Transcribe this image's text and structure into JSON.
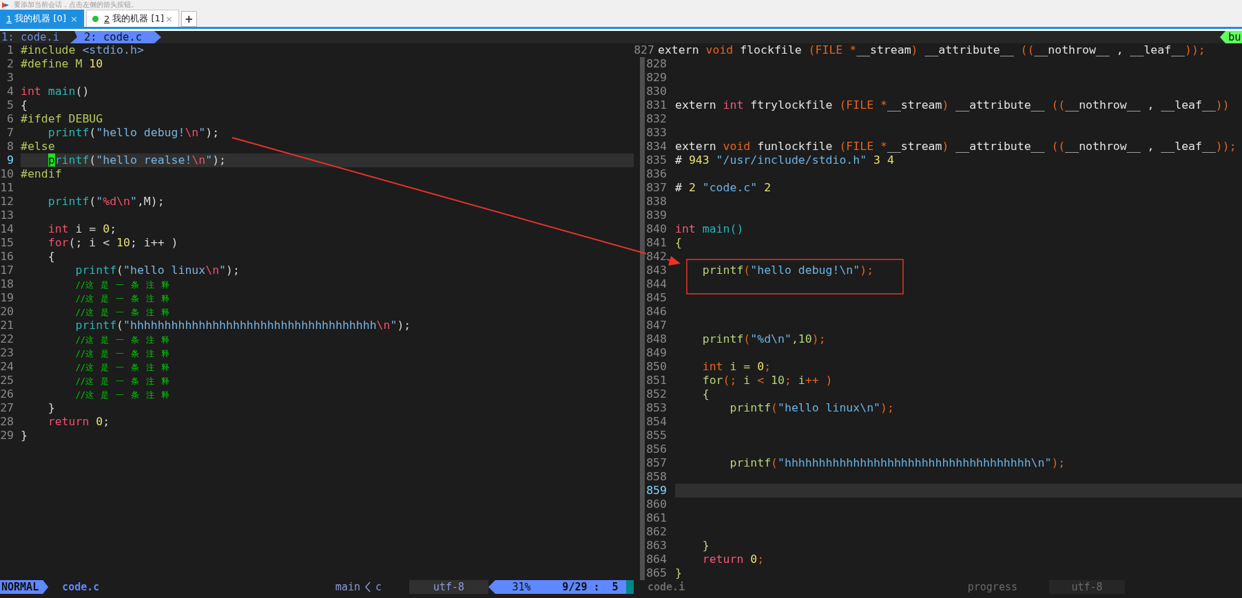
{
  "notice": {
    "text": "要添加当前会话，点击左侧的箭头按钮。"
  },
  "tabs": [
    {
      "number": "1",
      "label": "我的机器 [0]",
      "selected": true,
      "dot": false,
      "close": "×"
    },
    {
      "number": "2",
      "label": "我的机器 [1]",
      "selected": false,
      "dot": true,
      "close": "×"
    }
  ],
  "new_tab": "+",
  "vim_tabline": {
    "items": [
      {
        "label": "1: code.i",
        "selected": false
      },
      {
        "label": "2: code.c",
        "selected": true
      }
    ],
    "right_label": "bu"
  },
  "left_pane": {
    "lines": [
      {
        "n": "1",
        "cursorline": false,
        "tokens": [
          {
            "kind": "pre",
            "text": "#include "
          },
          {
            "kind": "incl",
            "text": "<stdio.h>"
          }
        ]
      },
      {
        "n": "2",
        "cursorline": false,
        "tokens": [
          {
            "kind": "pre",
            "text": "#define M "
          },
          {
            "kind": "num",
            "text": "10"
          }
        ]
      },
      {
        "n": "3",
        "cursorline": false
      },
      {
        "n": "4",
        "cursorline": false,
        "tokens": [
          {
            "kind": "kw",
            "text": "int"
          },
          {
            "kind": "fn",
            "text": " main"
          },
          {
            "kind": "plain",
            "text": "()"
          }
        ]
      },
      {
        "n": "5",
        "cursorline": false,
        "tokens": [
          {
            "kind": "plain",
            "text": "{"
          }
        ]
      },
      {
        "n": "6",
        "cursorline": false,
        "tokens": [
          {
            "kind": "pre",
            "text": "#ifdef DEBUG"
          }
        ]
      },
      {
        "n": "7",
        "cursorline": false,
        "tokens": [
          {
            "kind": "fn",
            "text": "    printf"
          },
          {
            "kind": "plain",
            "text": "("
          },
          {
            "kind": "str",
            "text": "\"hello debug!"
          },
          {
            "kind": "esc",
            "text": "\\n"
          },
          {
            "kind": "str",
            "text": "\""
          },
          {
            "kind": "plain",
            "text": ");"
          }
        ]
      },
      {
        "n": "8",
        "cursorline": false,
        "tokens": [
          {
            "kind": "pre",
            "text": "#else"
          }
        ]
      },
      {
        "n": "9",
        "cursorline": true,
        "tokens": [
          {
            "kind": "fn",
            "text": "    printf"
          },
          {
            "kind": "plain",
            "text": "("
          },
          {
            "kind": "str",
            "text": "\"hello realse!"
          },
          {
            "kind": "esc",
            "text": "\\n"
          },
          {
            "kind": "str",
            "text": "\""
          },
          {
            "kind": "plain",
            "text": ");"
          }
        ]
      },
      {
        "n": "10",
        "cursorline": false,
        "tokens": [
          {
            "kind": "pre",
            "text": "#endif"
          }
        ]
      },
      {
        "n": "11",
        "cursorline": false
      },
      {
        "n": "12",
        "cursorline": false,
        "tokens": [
          {
            "kind": "fn",
            "text": "    printf"
          },
          {
            "kind": "plain",
            "text": "("
          },
          {
            "kind": "str",
            "text": "\""
          },
          {
            "kind": "esc",
            "text": "%d\\n"
          },
          {
            "kind": "str",
            "text": "\""
          },
          {
            "kind": "plain",
            "text": ",M);"
          }
        ]
      },
      {
        "n": "13",
        "cursorline": false
      },
      {
        "n": "14",
        "cursorline": false,
        "tokens": [
          {
            "kind": "kw",
            "text": "    int"
          },
          {
            "kind": "plain",
            "text": " i = "
          },
          {
            "kind": "num",
            "text": "0"
          },
          {
            "kind": "plain",
            "text": ";"
          }
        ]
      },
      {
        "n": "15",
        "cursorline": false,
        "tokens": [
          {
            "kind": "kw",
            "text": "    for"
          },
          {
            "kind": "plain",
            "text": "(; i < "
          },
          {
            "kind": "num",
            "text": "10"
          },
          {
            "kind": "plain",
            "text": "; i++ )"
          }
        ]
      },
      {
        "n": "16",
        "cursorline": false,
        "tokens": [
          {
            "kind": "plain",
            "text": "    {"
          }
        ]
      },
      {
        "n": "17",
        "cursorline": false,
        "tokens": [
          {
            "kind": "fn",
            "text": "        printf"
          },
          {
            "kind": "plain",
            "text": "("
          },
          {
            "kind": "str",
            "text": "\"hello linux"
          },
          {
            "kind": "esc",
            "text": "\\n"
          },
          {
            "kind": "str",
            "text": "\""
          },
          {
            "kind": "plain",
            "text": ");"
          }
        ]
      },
      {
        "n": "18",
        "cursorline": false,
        "tokens": [
          {
            "kind": "cmt",
            "text": "        //这 是 一 条 注 释"
          }
        ]
      },
      {
        "n": "19",
        "cursorline": false,
        "tokens": [
          {
            "kind": "cmt",
            "text": "        //这 是 一 条 注 释"
          }
        ]
      },
      {
        "n": "20",
        "cursorline": false,
        "tokens": [
          {
            "kind": "cmt",
            "text": "        //这 是 一 条 注 释"
          }
        ]
      },
      {
        "n": "21",
        "cursorline": false,
        "tokens": [
          {
            "kind": "fn",
            "text": "        printf"
          },
          {
            "kind": "plain",
            "text": "("
          },
          {
            "kind": "str",
            "text": "\"hhhhhhhhhhhhhhhhhhhhhhhhhhhhhhhhhhhh"
          },
          {
            "kind": "esc",
            "text": "\\n"
          },
          {
            "kind": "str",
            "text": "\""
          },
          {
            "kind": "plain",
            "text": ");"
          }
        ]
      },
      {
        "n": "22",
        "cursorline": false,
        "tokens": [
          {
            "kind": "cmt",
            "text": "        //这 是 一 条 注 释"
          }
        ]
      },
      {
        "n": "23",
        "cursorline": false,
        "tokens": [
          {
            "kind": "cmt",
            "text": "        //这 是 一 条 注 释"
          }
        ]
      },
      {
        "n": "24",
        "cursorline": false,
        "tokens": [
          {
            "kind": "cmt",
            "text": "        //这 是 一 条 注 释"
          }
        ]
      },
      {
        "n": "25",
        "cursorline": false,
        "tokens": [
          {
            "kind": "cmt",
            "text": "        //这 是 一 条 注 释"
          }
        ]
      },
      {
        "n": "26",
        "cursorline": false,
        "tokens": [
          {
            "kind": "cmt",
            "text": "        //这 是 一 条 注 释"
          }
        ]
      },
      {
        "n": "27",
        "cursorline": false,
        "tokens": [
          {
            "kind": "plain",
            "text": "    }"
          }
        ]
      },
      {
        "n": "28",
        "cursorline": false,
        "tokens": [
          {
            "kind": "kw",
            "text": "    return"
          },
          {
            "kind": "num",
            "text": " 0"
          },
          {
            "kind": "plain",
            "text": ";"
          }
        ]
      },
      {
        "n": "29",
        "cursorline": false,
        "tokens": [
          {
            "kind": "plain",
            "text": "}"
          }
        ]
      }
    ]
  },
  "right_pane": {
    "fold_column": true,
    "header_line": {
      "n": "827",
      "tokens": [
        {
          "kind": "plain",
          "text": "extern "
        },
        {
          "kind": "type",
          "text": "void"
        },
        {
          "kind": "plain",
          "text": " flockfile "
        },
        {
          "kind": "punct",
          "text": "(FILE *"
        },
        {
          "kind": "plain",
          "text": "__stream"
        },
        {
          "kind": "punct",
          "text": ")"
        },
        {
          "kind": "plain",
          "text": " __attribute__ "
        },
        {
          "kind": "punct",
          "text": "(("
        },
        {
          "kind": "plain",
          "text": "__nothrow__ , __leaf__"
        },
        {
          "kind": "punct",
          "text": "));"
        }
      ]
    },
    "lines": [
      {
        "n": "828",
        "cursorline": false
      },
      {
        "n": "829",
        "cursorline": false
      },
      {
        "n": "830",
        "cursorline": false
      },
      {
        "n": "831",
        "cursorline": false,
        "tokens": [
          {
            "kind": "plain",
            "text": "extern "
          },
          {
            "kind": "kw",
            "text": "int"
          },
          {
            "kind": "plain",
            "text": " ftrylockfile "
          },
          {
            "kind": "punct",
            "text": "(FILE *"
          },
          {
            "kind": "plain",
            "text": "__stream"
          },
          {
            "kind": "punct",
            "text": ")"
          },
          {
            "kind": "plain",
            "text": " __attribute__ "
          },
          {
            "kind": "punct",
            "text": "(("
          },
          {
            "kind": "plain",
            "text": "__nothrow__ , __leaf__"
          },
          {
            "kind": "punct",
            "text": "))"
          }
        ]
      },
      {
        "n": "832",
        "cursorline": false
      },
      {
        "n": "833",
        "cursorline": false
      },
      {
        "n": "834",
        "cursorline": false,
        "tokens": [
          {
            "kind": "plain",
            "text": "extern "
          },
          {
            "kind": "type",
            "text": "void"
          },
          {
            "kind": "plain",
            "text": " funlockfile "
          },
          {
            "kind": "punct",
            "text": "(FILE *"
          },
          {
            "kind": "plain",
            "text": "__stream"
          },
          {
            "kind": "punct",
            "text": ")"
          },
          {
            "kind": "plain",
            "text": " __attribute__ "
          },
          {
            "kind": "punct",
            "text": "(("
          },
          {
            "kind": "plain",
            "text": "__nothrow__ , __leaf__"
          },
          {
            "kind": "punct",
            "text": "));"
          }
        ]
      },
      {
        "n": "835",
        "cursorline": false,
        "tokens": [
          {
            "kind": "plain",
            "text": "# "
          },
          {
            "kind": "num",
            "text": "943"
          },
          {
            "kind": "str",
            "text": " \"/usr/include/stdio.h\""
          },
          {
            "kind": "num",
            "text": " 3 4"
          }
        ]
      },
      {
        "n": "836",
        "cursorline": false
      },
      {
        "n": "837",
        "cursorline": false,
        "tokens": [
          {
            "kind": "plain",
            "text": "# "
          },
          {
            "kind": "num",
            "text": "2"
          },
          {
            "kind": "str",
            "text": " \"code.c\""
          },
          {
            "kind": "num",
            "text": " 2"
          }
        ]
      },
      {
        "n": "838",
        "cursorline": false
      },
      {
        "n": "839",
        "cursorline": false
      },
      {
        "n": "840",
        "cursorline": false,
        "tokens": [
          {
            "kind": "kw",
            "text": "int"
          },
          {
            "kind": "fn",
            "text": " main()"
          }
        ]
      },
      {
        "n": "841",
        "cursorline": false,
        "tokens": [
          {
            "kind": "brace",
            "text": "{"
          }
        ]
      },
      {
        "n": "842",
        "cursorline": false
      },
      {
        "n": "843",
        "cursorline": false,
        "tokens": [
          {
            "kind": "call",
            "text": "    printf"
          },
          {
            "kind": "punct",
            "text": "("
          },
          {
            "kind": "str",
            "text": "\"hello debug!\\n\""
          },
          {
            "kind": "punct",
            "text": ");"
          }
        ]
      },
      {
        "n": "844",
        "cursorline": false
      },
      {
        "n": "845",
        "cursorline": false
      },
      {
        "n": "846",
        "cursorline": false
      },
      {
        "n": "847",
        "cursorline": false
      },
      {
        "n": "848",
        "cursorline": false,
        "tokens": [
          {
            "kind": "call",
            "text": "    printf"
          },
          {
            "kind": "punct",
            "text": "("
          },
          {
            "kind": "str",
            "text": "\"%d\\n\""
          },
          {
            "kind": "brace",
            "text": ",10"
          },
          {
            "kind": "punct",
            "text": ");"
          }
        ]
      },
      {
        "n": "849",
        "cursorline": false
      },
      {
        "n": "850",
        "cursorline": false,
        "tokens": [
          {
            "kind": "type",
            "text": "    int"
          },
          {
            "kind": "brace",
            "text": " i = "
          },
          {
            "kind": "num",
            "text": "0"
          },
          {
            "kind": "punct",
            "text": ";"
          }
        ]
      },
      {
        "n": "851",
        "cursorline": false,
        "tokens": [
          {
            "kind": "brace",
            "text": "    for"
          },
          {
            "kind": "punct",
            "text": "(; "
          },
          {
            "kind": "brace",
            "text": "i "
          },
          {
            "kind": "punct",
            "text": "< "
          },
          {
            "kind": "brace",
            "text": "10"
          },
          {
            "kind": "punct",
            "text": "; "
          },
          {
            "kind": "brace",
            "text": "i"
          },
          {
            "kind": "punct",
            "text": "++ )"
          }
        ]
      },
      {
        "n": "852",
        "cursorline": false,
        "tokens": [
          {
            "kind": "brace",
            "text": "    {"
          }
        ]
      },
      {
        "n": "853",
        "cursorline": false,
        "tokens": [
          {
            "kind": "call",
            "text": "        printf"
          },
          {
            "kind": "punct",
            "text": "("
          },
          {
            "kind": "str",
            "text": "\"hello linux\\n\""
          },
          {
            "kind": "punct",
            "text": ");"
          }
        ]
      },
      {
        "n": "854",
        "cursorline": false
      },
      {
        "n": "855",
        "cursorline": false
      },
      {
        "n": "856",
        "cursorline": false
      },
      {
        "n": "857",
        "cursorline": false,
        "tokens": [
          {
            "kind": "call",
            "text": "        printf"
          },
          {
            "kind": "punct",
            "text": "("
          },
          {
            "kind": "str",
            "text": "\"hhhhhhhhhhhhhhhhhhhhhhhhhhhhhhhhhhhh\\n\""
          },
          {
            "kind": "punct",
            "text": ");"
          }
        ]
      },
      {
        "n": "858",
        "cursorline": false
      },
      {
        "n": "859",
        "cursorline": true
      },
      {
        "n": "860",
        "cursorline": false
      },
      {
        "n": "861",
        "cursorline": false
      },
      {
        "n": "862",
        "cursorline": false
      },
      {
        "n": "863",
        "cursorline": false,
        "tokens": [
          {
            "kind": "brace",
            "text": "    }"
          }
        ]
      },
      {
        "n": "864",
        "cursorline": false,
        "tokens": [
          {
            "kind": "kw",
            "text": "    return"
          },
          {
            "kind": "num",
            "text": " 0"
          },
          {
            "kind": "punct",
            "text": ";"
          }
        ]
      },
      {
        "n": "865",
        "cursorline": false,
        "tokens": [
          {
            "kind": "brace",
            "text": "}"
          }
        ]
      }
    ]
  },
  "left_status": {
    "active": true,
    "segments": [
      {
        "kind": "mode",
        "text": "NORMAL"
      },
      {
        "kind": "file",
        "text": "code.c"
      },
      {
        "kind": "func",
        "text": "main"
      },
      {
        "kind": "chevron"
      },
      {
        "kind": "lang",
        "text": "c"
      },
      {
        "kind": "enc",
        "text": "utf-8"
      },
      {
        "kind": "pct",
        "text": "31%"
      },
      {
        "kind": "pos",
        "text": "9/29 :  5"
      },
      {
        "kind": "end"
      }
    ]
  },
  "right_status": {
    "active": false,
    "segments": [
      {
        "kind": "file",
        "text": "code.i"
      },
      {
        "kind": "func",
        "text": "progress"
      },
      {
        "kind": "enc",
        "text": "utf-8"
      }
    ]
  },
  "annotations": {
    "arrow": true,
    "box": true
  }
}
